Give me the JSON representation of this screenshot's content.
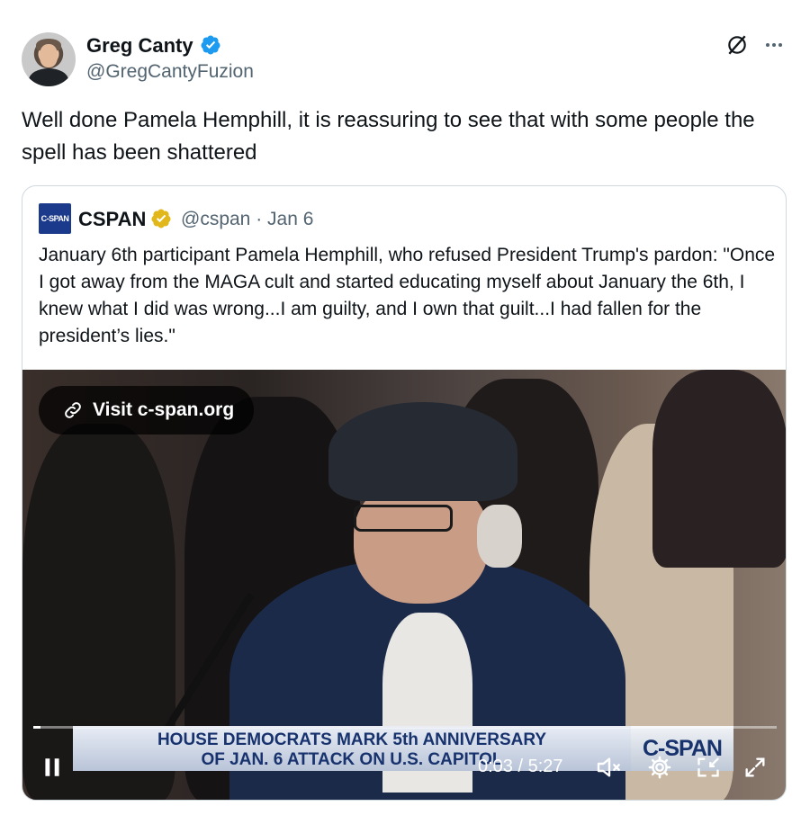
{
  "tweet": {
    "author_name": "Greg Canty",
    "author_handle": "@GregCantyFuzion",
    "text": "Well done Pamela Hemphill, it is reassuring to see that with some people the spell has been shattered"
  },
  "quoted": {
    "logo_text": "C-SPAN",
    "name": "CSPAN",
    "handle": "@cspan",
    "separator": "·",
    "date": "Jan 6",
    "text": "January 6th participant Pamela Hemphill, who refused President Trump's pardon: \"Once I got away from the MAGA cult and started educating myself about January the 6th, I knew what I did was wrong...I am guilty, and I own that guilt...I had fallen for the president’s lies.\""
  },
  "video": {
    "visit_link": "Visit c-span.org",
    "lower_third_line1": "HOUSE DEMOCRATS MARK 5th ANNIVERSARY",
    "lower_third_line2": "OF JAN. 6 ATTACK ON U.S. CAPITOL",
    "brand": "C-SPAN",
    "time": "0:03 / 5:27",
    "progress_fraction": 0.01
  },
  "colors": {
    "verified_blue": "#1d9bf0",
    "verified_gold": "#e2b719",
    "secondary_text": "#536471"
  },
  "icons": [
    "verified-badge-icon",
    "grok-icon",
    "more-icon",
    "link-icon",
    "pause-icon",
    "mute-icon",
    "settings-icon",
    "pip-icon",
    "fullscreen-icon"
  ]
}
